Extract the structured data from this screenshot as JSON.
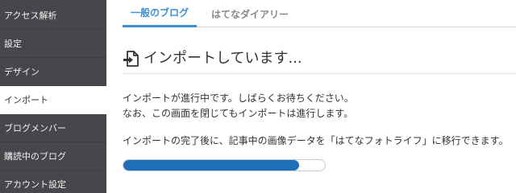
{
  "sidebar": {
    "items": [
      {
        "label": "アクセス解析",
        "active": false
      },
      {
        "label": "設定",
        "active": false
      },
      {
        "label": "デザイン",
        "active": false
      },
      {
        "label": "インポート",
        "active": true
      },
      {
        "label": "ブログメンバー",
        "active": false
      },
      {
        "label": "購読中のブログ",
        "active": false
      },
      {
        "label": "アカウント設定",
        "active": false
      }
    ]
  },
  "tabs": [
    {
      "label": "一般のブログ",
      "active": true
    },
    {
      "label": "はてなダイアリー",
      "active": false
    }
  ],
  "main": {
    "heading_icon": "file-import-icon",
    "heading": "インポートしています...",
    "message_line1": "インポートが進行中です。しばらくお待ちください。",
    "message_line2": "なお、この画面を閉じてもインポートは進行します。",
    "message_line3": "インポートの完了後に、記事中の画像データを「はてなフォトライフ」に移行できます。"
  },
  "progress": {
    "fraction": 0.87,
    "color": "#1f6fb8"
  },
  "colors": {
    "sidebar_bg": "#45474a",
    "accent": "#3a8fd6"
  }
}
